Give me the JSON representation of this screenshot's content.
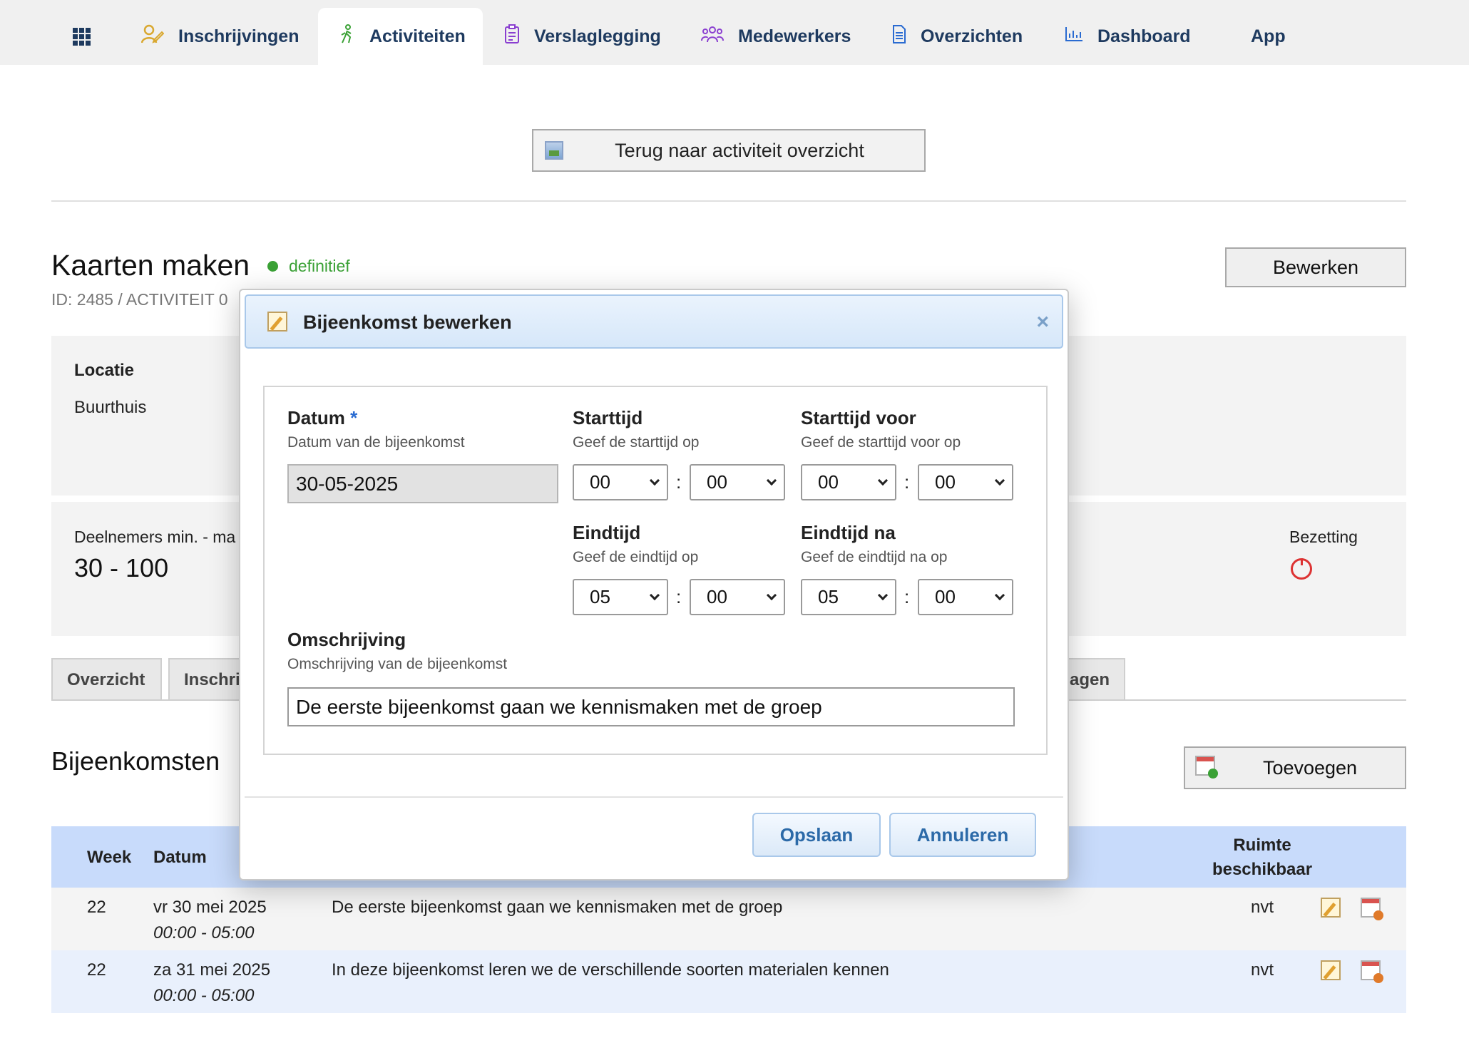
{
  "nav": {
    "apps_icon": "grid-icon",
    "items": [
      {
        "label": "Inschrijvingen",
        "icon": "signup-icon",
        "color": "#d9a830"
      },
      {
        "label": "Activiteiten",
        "icon": "walking-icon",
        "color": "#3aa135"
      },
      {
        "label": "Verslaglegging",
        "icon": "clipboard-icon",
        "color": "#8a3fd0"
      },
      {
        "label": "Medewerkers",
        "icon": "people-icon",
        "color": "#8a3fd0"
      },
      {
        "label": "Overzichten",
        "icon": "document-icon",
        "color": "#2a6bd1"
      },
      {
        "label": "Dashboard",
        "icon": "chart-icon",
        "color": "#2a6bd1"
      },
      {
        "label": "App",
        "icon": "",
        "color": ""
      }
    ],
    "active": "Activiteiten"
  },
  "back_button": "Terug naar activiteit overzicht",
  "activity": {
    "title": "Kaarten maken",
    "status": "definitief",
    "id_line": "ID: 2485 / ACTIVITEIT 0",
    "edit_button": "Bewerken",
    "location_label": "Locatie",
    "location_value": "Buurthuis",
    "participants_label": "Deelnemers min. - ma",
    "participants_value": "30 - 100",
    "occupancy_label": "Bezetting"
  },
  "tabs": [
    "Overzicht",
    "Inschri",
    "agen"
  ],
  "meetings": {
    "title": "Bijeenkomsten",
    "add_button": "Toevoegen",
    "headers": {
      "week": "Week",
      "date": "Datum",
      "room_1": "Ruimte",
      "room_2": "beschikbaar"
    },
    "rows": [
      {
        "week": "22",
        "date": "vr 30 mei 2025",
        "time": "00:00 - 05:00",
        "description": "De eerste bijeenkomst gaan we kennismaken met de groep",
        "room": "nvt"
      },
      {
        "week": "22",
        "date": "za 31 mei 2025",
        "time": "00:00 - 05:00",
        "description": "In deze bijeenkomst leren we de verschillende soorten materialen kennen",
        "room": "nvt"
      }
    ]
  },
  "dialog": {
    "title": "Bijeenkomst bewerken",
    "close": "×",
    "date_label": "Datum",
    "required_mark": "*",
    "date_hint": "Datum van de bijeenkomst",
    "date_value": "30-05-2025",
    "start_label": "Starttijd",
    "start_hint": "Geef de starttijd op",
    "start_hour": "00",
    "start_min": "00",
    "start_before_label": "Starttijd voor",
    "start_before_hint": "Geef de starttijd voor op",
    "start_before_hour": "00",
    "start_before_min": "00",
    "end_label": "Eindtijd",
    "end_hint": "Geef de eindtijd op",
    "end_hour": "05",
    "end_min": "00",
    "end_after_label": "Eindtijd na",
    "end_after_hint": "Geef de eindtijd na op",
    "end_after_hour": "05",
    "end_after_min": "00",
    "colon": ":",
    "desc_label": "Omschrijving",
    "desc_hint": "Omschrijving van de bijeenkomst",
    "desc_value": "De eerste bijeenkomst gaan we kennismaken met de groep",
    "save_button": "Opslaan",
    "cancel_button": "Annuleren"
  }
}
